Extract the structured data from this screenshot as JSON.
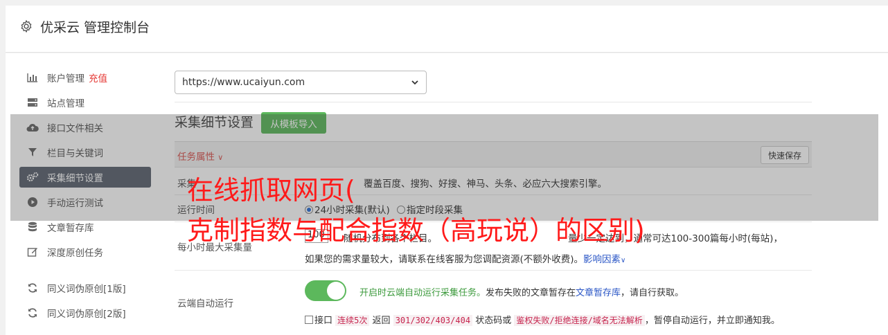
{
  "header": {
    "title": "优采云 管理控制台",
    "icon": "gear-icon"
  },
  "sidebar": {
    "items": [
      {
        "label": "账户管理",
        "extra": "充值",
        "icon": "bar-chart-icon"
      },
      {
        "label": "站点管理",
        "icon": "server-icon"
      },
      {
        "label": "接口文件相关",
        "icon": "cloud-upload-icon"
      },
      {
        "label": "栏目与关键词",
        "icon": "filter-icon"
      },
      {
        "label": "采集细节设置",
        "icon": "gears-icon",
        "active": true
      },
      {
        "label": "手动运行测试",
        "icon": "play-circle-icon"
      },
      {
        "label": "文章暂存库",
        "icon": "database-icon"
      },
      {
        "label": "深度原创任务",
        "icon": "edit-icon"
      },
      {
        "label": "同义词伪原创[1版]",
        "icon": "refresh-icon"
      },
      {
        "label": "同义词伪原创[2版]",
        "icon": "refresh-icon"
      }
    ]
  },
  "site_select": {
    "value": "https://www.ucaiyun.com"
  },
  "section": {
    "title": "采集细节设置",
    "import_button": "从模板导入"
  },
  "tabs": {
    "task_props": "任务属性",
    "quick_save": "快速保存"
  },
  "rows": {
    "source": {
      "label": "采集",
      "value": "覆盖百度、搜狗、好搜、神马、头条、必应六大搜索引擎。"
    },
    "run_time": {
      "label": "运行时间",
      "option_1": "24小时采集(默认)",
      "option_2": "指定时段采集"
    },
    "max_per_hour": {
      "label": "每小时最大采集量",
      "input_value": "100",
      "line_1_prefix": "随机分布到各个栏目。",
      "line_1_suffix": "量少一定达到，通常可达100-300篇每小时(每站)，",
      "line_2": "如果您的需求量较大，请联系在线客服为您调配资源(不额外收费)。",
      "link": "影响因素"
    },
    "cloud": {
      "label": "云端自动运行",
      "desc_green": "开启时云端自动运行采集任务。",
      "desc_1": "发布失败的文章暂存在",
      "desc_link": "文章暂存库",
      "desc_2": "，请自行获取。",
      "check_1": "接口",
      "code_1": "连续5次",
      "check_2": "返回",
      "code_2": "301/302/403/404",
      "check_3": "状态码或",
      "code_3": "鉴权失败/拒绝连接/域名无法解析",
      "check_4": "，暂停自动运行，并立即通知我。"
    }
  },
  "overlay": {
    "line_1": "在线抓取网页(",
    "line_2": "克制指数与配合指数（高玩说）的区别)"
  },
  "colors": {
    "accent_green": "#5cb85c",
    "active_nav": "#5c6470",
    "caption_red": "#ff1a1a",
    "link_blue": "#2a56c6"
  }
}
